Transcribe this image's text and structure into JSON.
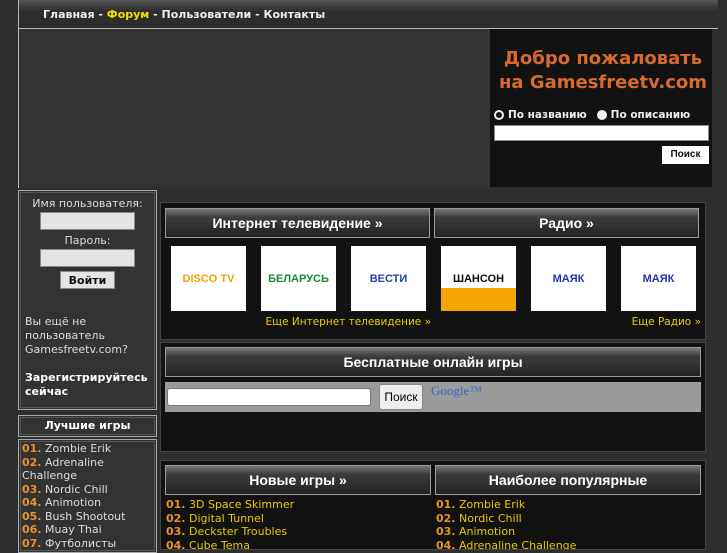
{
  "nav": {
    "items": [
      {
        "label": "Главная"
      },
      {
        "label": "Форум",
        "active": true
      },
      {
        "label": "Пользователи"
      },
      {
        "label": "Контакты"
      }
    ],
    "separator": " - "
  },
  "welcome": {
    "title_line1": "Добро пожаловать",
    "title_line2": "на Gamesfreetv.com",
    "radio_name": "По названию",
    "radio_desc": "По описанию",
    "search_value": "",
    "search_button": "Поиск"
  },
  "login": {
    "username_label": "Имя пользователя:",
    "password_label": "Пароль:",
    "login_button": "Войти",
    "not_user_text": "Вы ещё не пользователь Gamesfreetv.com?",
    "register_link": "Зарегистрируйтесь сейчас"
  },
  "best_games": {
    "title": "Лучшие игры",
    "items": [
      {
        "num": "01.",
        "name": "Zombie Erik"
      },
      {
        "num": "02.",
        "name": "Adrenaline Challenge"
      },
      {
        "num": "03.",
        "name": "Nordic Chill"
      },
      {
        "num": "04.",
        "name": "Animotion"
      },
      {
        "num": "05.",
        "name": "Bush Shootout"
      },
      {
        "num": "06.",
        "name": "Muay Thai"
      },
      {
        "num": "07.",
        "name": "Футболисты"
      }
    ]
  },
  "tv": {
    "title": "Интернет телевидение »",
    "more": "Еще Интернет телевидение »",
    "logos": [
      {
        "name": "DISCO TV",
        "color": "#f5a000"
      },
      {
        "name": "БЕЛАРУСЬ",
        "color": "#1a8a3a"
      },
      {
        "name": "ВЕСТИ",
        "color": "#2244aa"
      }
    ]
  },
  "radio": {
    "title": "Радио »",
    "more": "Еще Радио »",
    "logos": [
      {
        "name": "ШАНСОН",
        "color": "#111111"
      },
      {
        "name": "МАЯК",
        "color": "#2233aa"
      },
      {
        "name": "МАЯК",
        "color": "#2233aa"
      }
    ]
  },
  "free_games": {
    "title": "Бесплатные онлайн игры",
    "search_value": "",
    "search_button": "Поиск",
    "google_logo": "Google™"
  },
  "new_games": {
    "title": "Новые игры »",
    "items": [
      {
        "num": "01.",
        "name": "3D Space Skimmer"
      },
      {
        "num": "02.",
        "name": "Digital Tunnel"
      },
      {
        "num": "03.",
        "name": "Deckster Troubles"
      },
      {
        "num": "04.",
        "name": "Cube Tema"
      }
    ]
  },
  "popular": {
    "title": "Наиболее популярные",
    "items": [
      {
        "num": "01.",
        "name": "Zombie Erik"
      },
      {
        "num": "02.",
        "name": "Nordic Chill"
      },
      {
        "num": "03.",
        "name": "Animotion"
      },
      {
        "num": "04.",
        "name": "Adrenaline Challenge"
      }
    ]
  },
  "colors": {
    "accent_orange": "#d86a2c",
    "link_yellow": "#e8d000",
    "active_nav": "#f0e000"
  }
}
